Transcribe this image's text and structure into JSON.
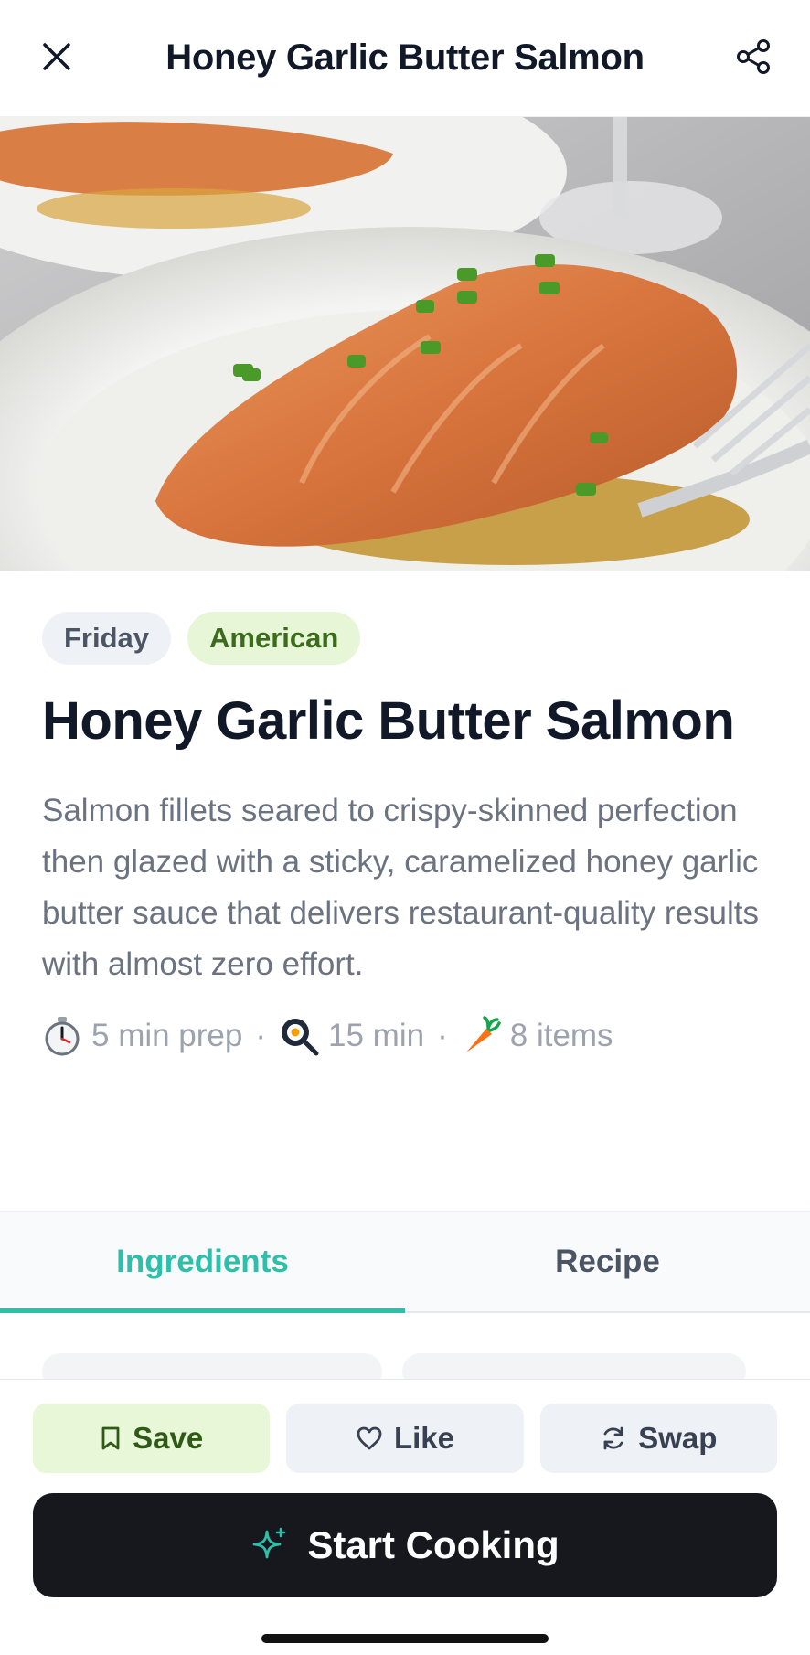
{
  "header": {
    "title": "Honey Garlic Butter Salmon"
  },
  "hero": {
    "alt": "Honey garlic butter salmon on a plate"
  },
  "tags": {
    "day": "Friday",
    "cuisine": "American"
  },
  "recipe": {
    "title": "Honey Garlic Butter Salmon",
    "description": "Salmon fillets seared to crispy-skinned perfection then glazed with a sticky, caramelized honey garlic butter sauce that delivers restaurant-quality results with almost zero effort.",
    "prep": "5 min prep",
    "cook": "15 min",
    "items": "8 items",
    "separator": "·"
  },
  "tabs": [
    {
      "label": "Ingredients",
      "active": true
    },
    {
      "label": "Recipe",
      "active": false
    }
  ],
  "actions": {
    "save": "Save",
    "like": "Like",
    "swap": "Swap"
  },
  "cta": {
    "label": "Start Cooking"
  },
  "colors": {
    "accent": "#2dbfa9",
    "save_bg": "#e9f7d9",
    "cta_bg": "#16181d"
  },
  "icons": [
    "close-icon",
    "share-icon",
    "stopwatch-icon",
    "frying-pan-icon",
    "carrot-icon",
    "bookmark-icon",
    "heart-icon",
    "swap-icon",
    "sparkle-icon"
  ]
}
